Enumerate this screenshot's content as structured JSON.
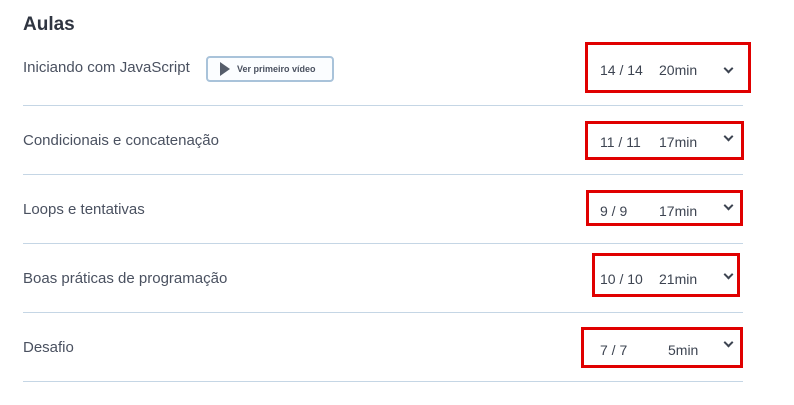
{
  "section_title": "Aulas",
  "first_video_button": {
    "label": "Ver primeiro vídeo",
    "icon": "play-icon"
  },
  "chevron_icon": "chevron-down-icon",
  "highlight_color": "#e00000",
  "lessons": [
    {
      "name": "Iniciando com JavaScript",
      "count": "14 / 14",
      "duration": "20min"
    },
    {
      "name": "Condicionais e concatenação",
      "count": "11 / 11",
      "duration": "17min"
    },
    {
      "name": "Loops e tentativas",
      "count": "9 / 9",
      "duration": "17min"
    },
    {
      "name": "Boas práticas de programação",
      "count": "10 / 10",
      "duration": "21min"
    },
    {
      "name": "Desafio",
      "count": "7 / 7",
      "duration": "5min"
    }
  ]
}
